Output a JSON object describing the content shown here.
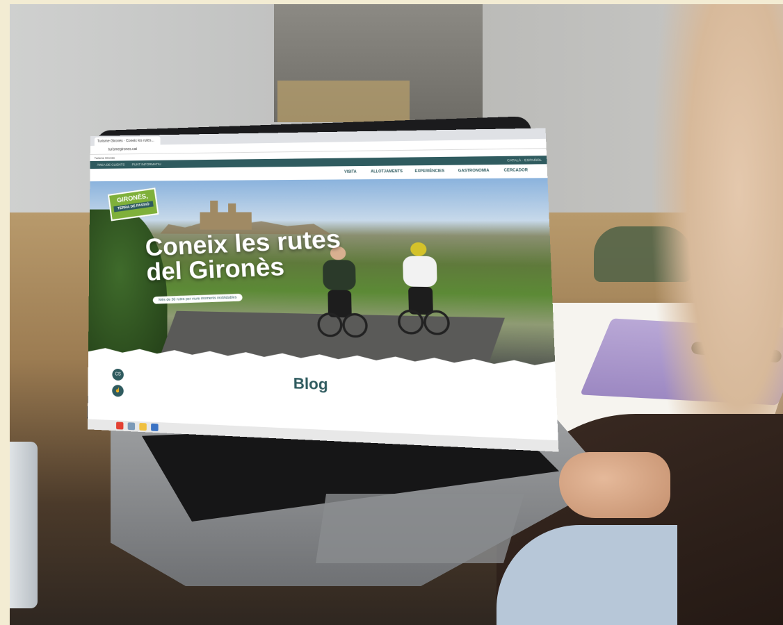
{
  "browser": {
    "tab_title": "Turisme Gironès · Coneix les rutes...",
    "url": "turismegirones.cat",
    "bookmark": "Turisme Gironès"
  },
  "site": {
    "topbar_left": "ÀREA DE CLIENTS",
    "topbar_left2": "PUNT INFORMATIU",
    "topbar_right": "CATALÀ · ESPAÑOL",
    "nav": [
      "VISITA",
      "ALLOTJAMENTS",
      "EXPERIÈNCIES",
      "GASTRONOMIA",
      "CERCADOR"
    ],
    "logo_line1": "GIRONÈS,",
    "logo_line2": "TERRA DE PASSIÓ",
    "hero_title_line1": "Coneix les rutes",
    "hero_title_line2": "del Gironès",
    "hero_pill": "Més de 30 rutes per viure moments inoblidables",
    "section_heading": "Blog",
    "float_buttons": [
      "CS",
      "☝"
    ]
  },
  "colors": {
    "brand_teal": "#2f5b5f",
    "brand_green": "#7fb03a"
  }
}
